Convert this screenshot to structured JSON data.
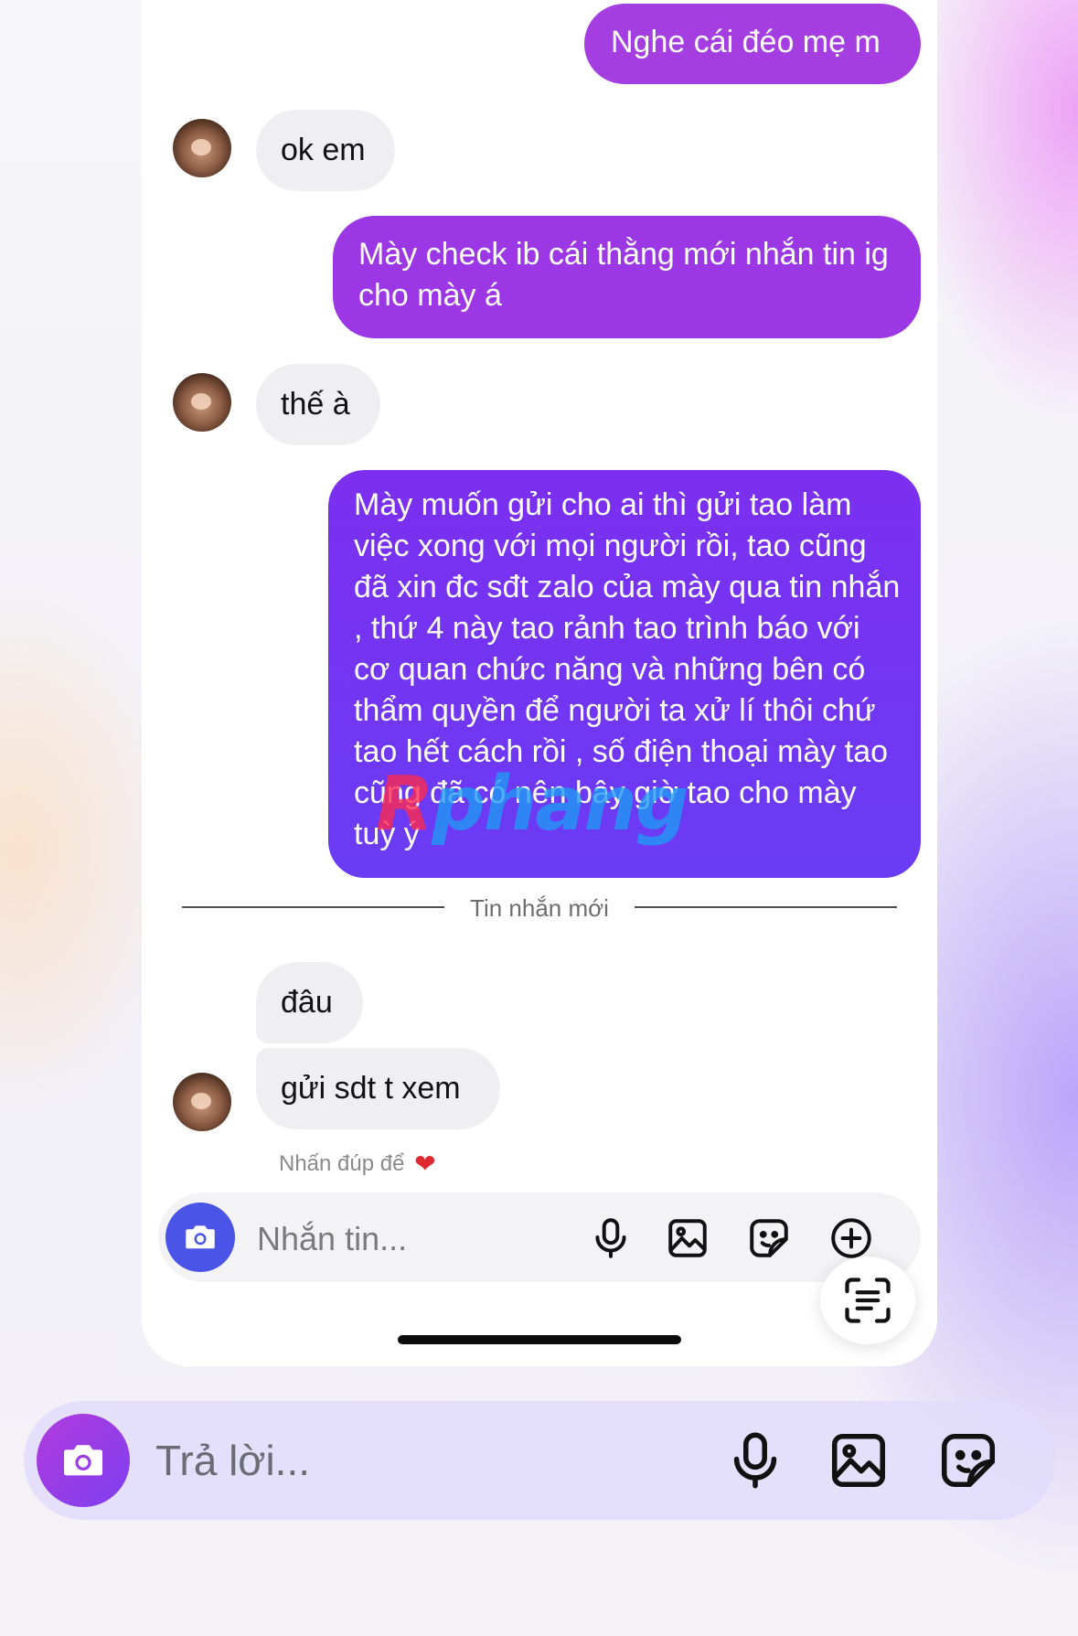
{
  "messages": {
    "m1": "Nghe cái đéo mẹ m",
    "m2": "ok em",
    "m3": "Mày check ib cái thằng mới nhắn tin ig cho mày á",
    "m4": "thế à",
    "m5": "Mày muốn gửi cho ai thì gửi tao làm việc xong với mọi người rồi, tao cũng đã xin đc sđt zalo của mày qua tin nhắn , thứ 4 này tao rảnh tao trình báo với cơ quan chức năng và những bên có thẩm quyền để người ta xử lí thôi chứ tao hết cách rồi , số điện thoại mày tao cũng đã có nên bây giờ tao cho mày tuỳ ý",
    "m6": "đâu",
    "m7": "gửi sdt t xem"
  },
  "divider_label": "Tin nhắn mới",
  "reaction_hint": "Nhấn đúp để",
  "reaction_emoji": "❤",
  "compose": {
    "placeholder": "Nhắn tin..."
  },
  "reply": {
    "placeholder": "Trả lời..."
  },
  "watermark": {
    "first": "R",
    "rest": "phang"
  },
  "colors": {
    "outgoing_pink": "#a43ee0",
    "outgoing_violet": "#7c2ff0",
    "incoming_gray": "#efeff1",
    "camera_blue": "#4a55e8"
  },
  "icons": [
    "camera-icon",
    "microphone-icon",
    "gallery-icon",
    "sticker-icon",
    "add-icon",
    "scan-text-icon"
  ]
}
